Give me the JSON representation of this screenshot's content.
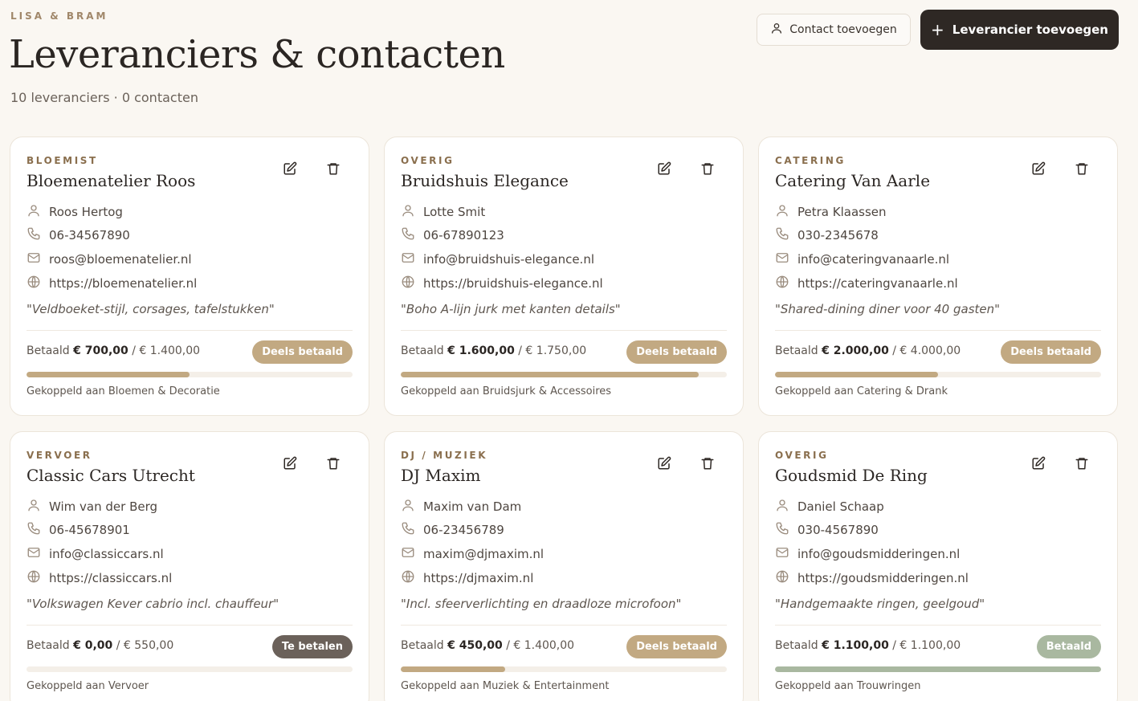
{
  "header": {
    "brand": "LISA & BRAM",
    "title": "Leveranciers & contacten",
    "subtitle": "10 leveranciers · 0 contacten",
    "add_contact_label": "Contact toevoegen",
    "add_supplier_label": "Leverancier toevoegen"
  },
  "colors": {
    "partial": "#c2a982",
    "unpaid": "#6b615a",
    "paid": "#a9b8a0",
    "bar_partial": "#c2a982",
    "bar_paid": "#a9b8a0"
  },
  "suppliers": [
    {
      "category": "BLOEMIST",
      "name": "Bloemenatelier Roos",
      "contact": "Roos Hertog",
      "phone": "06-34567890",
      "email": "roos@bloemenatelier.nl",
      "website": "https://bloemenatelier.nl",
      "note": "\"Veldboeket-stijl, corsages, tafelstukken\"",
      "paid_prefix": "Betaald",
      "paid_amount": "€ 700,00",
      "total": "/ € 1.400,00",
      "status": "Deels betaald",
      "status_kind": "partial",
      "progress": 0.5,
      "linked": "Gekoppeld aan Bloemen & Decoratie"
    },
    {
      "category": "OVERIG",
      "name": "Bruidshuis Elegance",
      "contact": "Lotte Smit",
      "phone": "06-67890123",
      "email": "info@bruidshuis-elegance.nl",
      "website": "https://bruidshuis-elegance.nl",
      "note": "\"Boho A-lijn jurk met kanten details\"",
      "paid_prefix": "Betaald",
      "paid_amount": "€ 1.600,00",
      "total": "/ € 1.750,00",
      "status": "Deels betaald",
      "status_kind": "partial",
      "progress": 0.914,
      "linked": "Gekoppeld aan Bruidsjurk & Accessoires"
    },
    {
      "category": "CATERING",
      "name": "Catering Van Aarle",
      "contact": "Petra Klaassen",
      "phone": "030-2345678",
      "email": "info@cateringvanaarle.nl",
      "website": "https://cateringvanaarle.nl",
      "note": "\"Shared-dining diner voor 40 gasten\"",
      "paid_prefix": "Betaald",
      "paid_amount": "€ 2.000,00",
      "total": "/ € 4.000,00",
      "status": "Deels betaald",
      "status_kind": "partial",
      "progress": 0.5,
      "linked": "Gekoppeld aan Catering & Drank"
    },
    {
      "category": "VERVOER",
      "name": "Classic Cars Utrecht",
      "contact": "Wim van der Berg",
      "phone": "06-45678901",
      "email": "info@classiccars.nl",
      "website": "https://classiccars.nl",
      "note": "\"Volkswagen Kever cabrio incl. chauffeur\"",
      "paid_prefix": "Betaald",
      "paid_amount": "€ 0,00",
      "total": "/ € 550,00",
      "status": "Te betalen",
      "status_kind": "unpaid",
      "progress": 0,
      "linked": "Gekoppeld aan Vervoer"
    },
    {
      "category": "DJ / MUZIEK",
      "name": "DJ Maxim",
      "contact": "Maxim van Dam",
      "phone": "06-23456789",
      "email": "maxim@djmaxim.nl",
      "website": "https://djmaxim.nl",
      "note": "\"Incl. sfeerverlichting en draadloze microfoon\"",
      "paid_prefix": "Betaald",
      "paid_amount": "€ 450,00",
      "total": "/ € 1.400,00",
      "status": "Deels betaald",
      "status_kind": "partial",
      "progress": 0.321,
      "linked": "Gekoppeld aan Muziek & Entertainment"
    },
    {
      "category": "OVERIG",
      "name": "Goudsmid De Ring",
      "contact": "Daniel Schaap",
      "phone": "030-4567890",
      "email": "info@goudsmidderingen.nl",
      "website": "https://goudsmidderingen.nl",
      "note": "\"Handgemaakte ringen, geelgoud\"",
      "paid_prefix": "Betaald",
      "paid_amount": "€ 1.100,00",
      "total": "/ € 1.100,00",
      "status": "Betaald",
      "status_kind": "paid",
      "progress": 1.0,
      "linked": "Gekoppeld aan Trouwringen"
    }
  ]
}
